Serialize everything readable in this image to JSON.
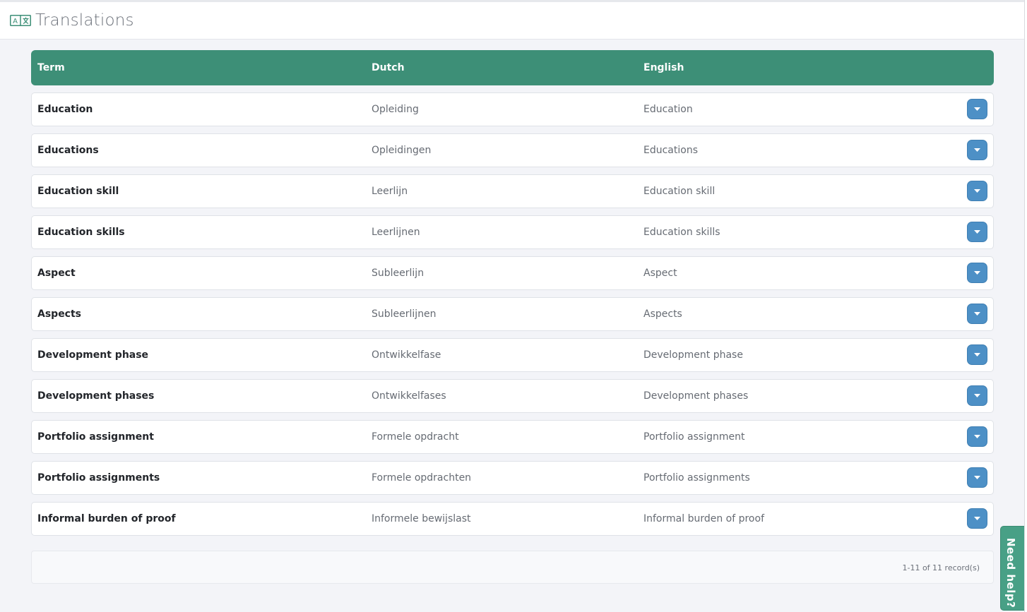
{
  "page": {
    "title": "Translations",
    "icon": "translate-icon"
  },
  "table": {
    "columns": {
      "term": "Term",
      "dutch": "Dutch",
      "english": "English"
    },
    "rows": [
      {
        "term": "Education",
        "dutch": "Opleiding",
        "english": "Education"
      },
      {
        "term": "Educations",
        "dutch": "Opleidingen",
        "english": "Educations"
      },
      {
        "term": "Education skill",
        "dutch": "Leerlijn",
        "english": "Education skill"
      },
      {
        "term": "Education skills",
        "dutch": "Leerlijnen",
        "english": "Education skills"
      },
      {
        "term": "Aspect",
        "dutch": "Subleerlijn",
        "english": "Aspect"
      },
      {
        "term": "Aspects",
        "dutch": "Subleerlijnen",
        "english": "Aspects"
      },
      {
        "term": "Development phase",
        "dutch": "Ontwikkelfase",
        "english": "Development phase"
      },
      {
        "term": "Development phases",
        "dutch": "Ontwikkelfases",
        "english": "Development phases"
      },
      {
        "term": "Portfolio assignment",
        "dutch": "Formele opdracht",
        "english": "Portfolio assignment"
      },
      {
        "term": "Portfolio assignments",
        "dutch": "Formele opdrachten",
        "english": "Portfolio assignments"
      },
      {
        "term": "Informal burden of proof",
        "dutch": "Informele bewijslast",
        "english": "Informal burden of proof"
      }
    ],
    "row_action_icon": "caret-down-icon"
  },
  "footer": {
    "record_count": "1-11 of 11 record(s)"
  },
  "help": {
    "label": "Need help?"
  },
  "colors": {
    "header_green": "#3d8f77",
    "action_blue": "#4d90c6",
    "help_green": "#48a086"
  }
}
